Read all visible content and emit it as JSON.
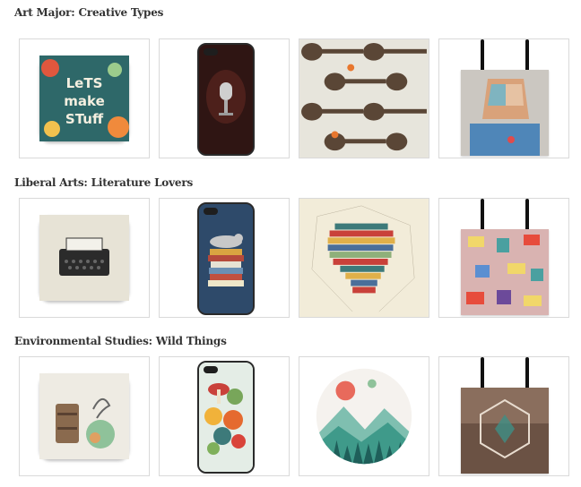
{
  "sections": [
    {
      "title": "Art Major: Creative Types",
      "products": [
        {
          "kind": "throw-pillow",
          "design": "lets-make-stuff-lettering"
        },
        {
          "kind": "phone-case",
          "design": "vintage-microphone"
        },
        {
          "kind": "art-print",
          "design": "guitars-and-birds"
        },
        {
          "kind": "tote-bag",
          "design": "geometric-portrait"
        }
      ]
    },
    {
      "title": "Liberal Arts: Literature Lovers",
      "products": [
        {
          "kind": "throw-pillow",
          "design": "typewriter"
        },
        {
          "kind": "phone-case",
          "design": "cat-on-books"
        },
        {
          "kind": "art-print",
          "design": "book-head-silhouette"
        },
        {
          "kind": "tote-bag",
          "design": "reading-pattern"
        }
      ]
    },
    {
      "title": "Environmental Studies: Wild Things",
      "products": [
        {
          "kind": "throw-pillow",
          "design": "suitcase-tree"
        },
        {
          "kind": "phone-case",
          "design": "mushroom-flowers"
        },
        {
          "kind": "art-print",
          "design": "round-forest-landscape"
        },
        {
          "kind": "tote-bag",
          "design": "geometric-landscape"
        }
      ]
    }
  ]
}
